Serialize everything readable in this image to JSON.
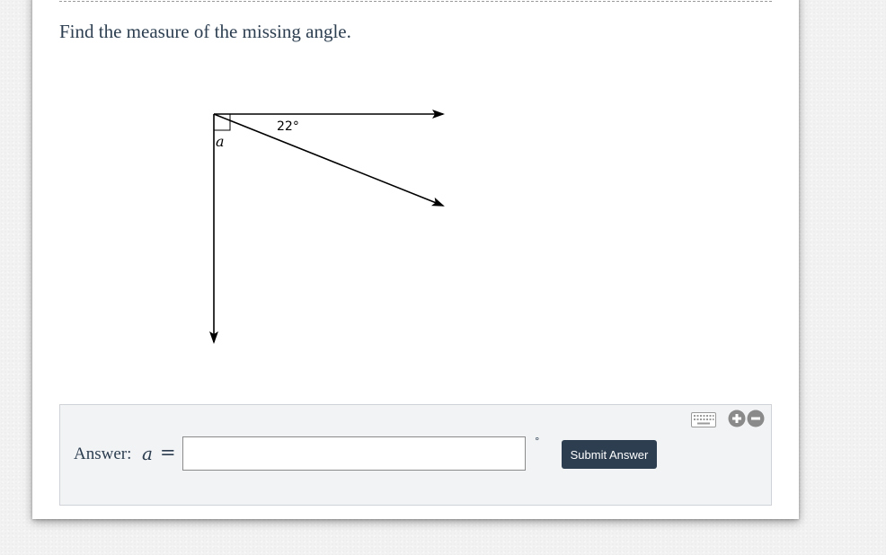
{
  "question": {
    "text": "Find the measure of the missing angle."
  },
  "diagram": {
    "given_angle_label": "22°",
    "unknown_angle_label": "a",
    "right_angle_marker": true
  },
  "answer": {
    "label": "Answer:",
    "variable": "a",
    "equals": "=",
    "input_value": "",
    "unit": "°",
    "submit_label": "Submit Answer"
  },
  "tools": {
    "icons": [
      "keyboard-icon",
      "zoom-in-icon",
      "zoom-out-icon"
    ]
  },
  "colors": {
    "text": "#2c3e50",
    "button_bg": "#2c3e50",
    "button_text": "#ffffff",
    "panel_bg": "#f2f3f5",
    "icon_gray": "#888888"
  }
}
